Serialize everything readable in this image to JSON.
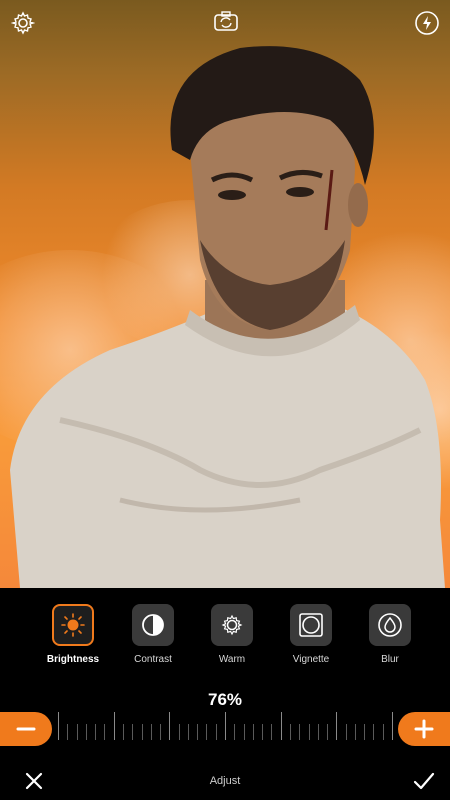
{
  "top_bar": {
    "settings_icon": "gear-icon",
    "camera_icon": "camera-switch-icon",
    "flash_icon": "flash-icon"
  },
  "tools": [
    {
      "label": "Brightness",
      "icon": "sun-icon",
      "active": true
    },
    {
      "label": "Contrast",
      "icon": "half-circle-icon",
      "active": false
    },
    {
      "label": "Warm",
      "icon": "gear-sun-icon",
      "active": false
    },
    {
      "label": "Vignette",
      "icon": "vignette-icon",
      "active": false
    },
    {
      "label": "Blur",
      "icon": "drop-icon",
      "active": false
    }
  ],
  "adjust": {
    "value_text": "76%",
    "value": 76,
    "minus_label": "−",
    "plus_label": "+"
  },
  "bottom": {
    "title": "Adjust",
    "cancel_icon": "close-icon",
    "confirm_icon": "check-icon"
  },
  "colors": {
    "accent": "#f07a1c",
    "background_top": "#7a5a1f",
    "background_bottom": "#f5883a"
  }
}
